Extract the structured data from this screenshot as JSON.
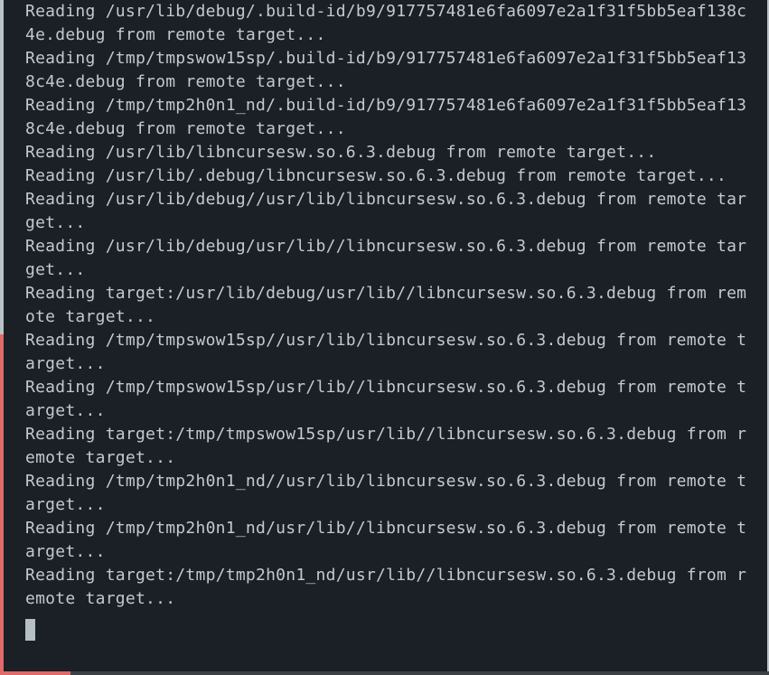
{
  "terminal": {
    "lines": [
      "Reading /usr/lib/debug/.build-id/b9/917757481e6fa6097e2a1f31f5bb5eaf138c",
      "4e.debug from remote target...",
      "Reading /tmp/tmpswow15sp/.build-id/b9/917757481e6fa6097e2a1f31f5bb5eaf13",
      "8c4e.debug from remote target...",
      "Reading /tmp/tmp2h0n1_nd/.build-id/b9/917757481e6fa6097e2a1f31f5bb5eaf13",
      "8c4e.debug from remote target...",
      "Reading /usr/lib/libncursesw.so.6.3.debug from remote target...",
      "Reading /usr/lib/.debug/libncursesw.so.6.3.debug from remote target...",
      "Reading /usr/lib/debug//usr/lib/libncursesw.so.6.3.debug from remote tar",
      "get...",
      "Reading /usr/lib/debug/usr/lib//libncursesw.so.6.3.debug from remote tar",
      "get...",
      "Reading target:/usr/lib/debug/usr/lib//libncursesw.so.6.3.debug from rem",
      "ote target...",
      "Reading /tmp/tmpswow15sp//usr/lib/libncursesw.so.6.3.debug from remote t",
      "arget...",
      "Reading /tmp/tmpswow15sp/usr/lib//libncursesw.so.6.3.debug from remote t",
      "arget...",
      "Reading target:/tmp/tmpswow15sp/usr/lib//libncursesw.so.6.3.debug from r",
      "emote target...",
      "Reading /tmp/tmp2h0n1_nd//usr/lib/libncursesw.so.6.3.debug from remote t",
      "arget...",
      "Reading /tmp/tmp2h0n1_nd/usr/lib//libncursesw.so.6.3.debug from remote t",
      "arget...",
      "Reading target:/tmp/tmp2h0n1_nd/usr/lib//libncursesw.so.6.3.debug from r",
      "emote target..."
    ]
  },
  "colors": {
    "background": "#1a2026",
    "text": "#c3c9ce",
    "cursor": "#b5c0c4"
  }
}
